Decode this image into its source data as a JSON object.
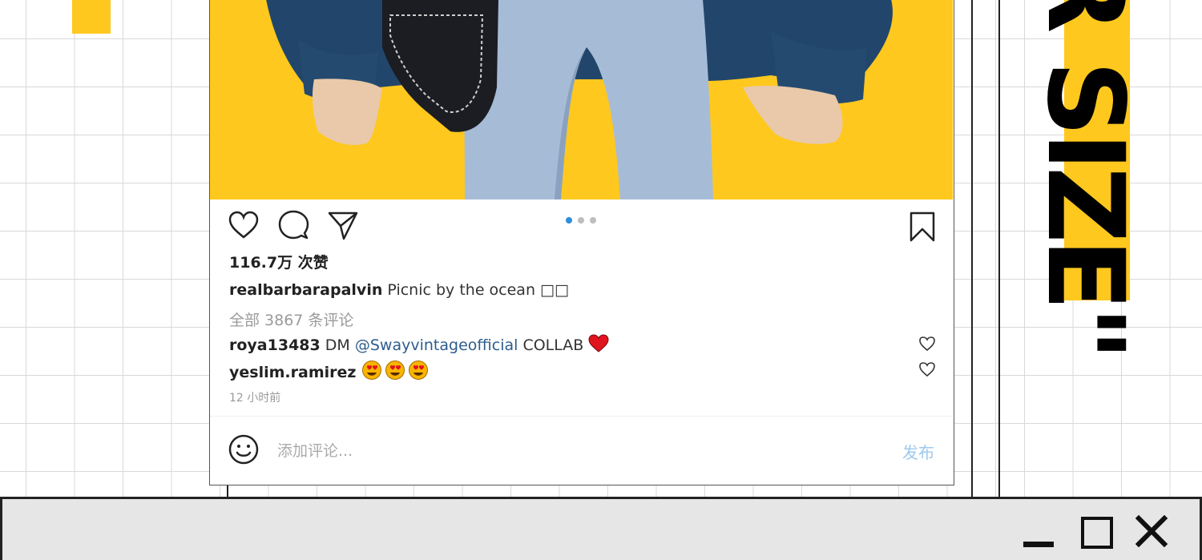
{
  "post": {
    "likes": "116.7万 次赞",
    "caption_user": "realbarbarapalvin",
    "caption_text": "Picnic by the ocean □□",
    "view_all_comments": "全部 3867 条评论",
    "comments": [
      {
        "user": "roya13483",
        "text_before": "DM",
        "mention": "@Swayvintageofficial",
        "text_after": "COLLAB",
        "emoji": "red-heart"
      },
      {
        "user": "yeslim.ramirez",
        "emoji": "heart-eyes x3"
      }
    ],
    "time": "12 小时前",
    "comment_placeholder": "添加评论...",
    "post_button": "发布",
    "carousel_dots": 3,
    "carousel_active_index": 0
  },
  "decor": {
    "side_text": "R SIZE\"",
    "accent_color": "#ffc81e",
    "link_color": "#2c5d8e",
    "active_dot_color": "#2f8ddd"
  },
  "icons": {
    "actions": [
      "heart-icon",
      "comment-icon",
      "share-icon"
    ],
    "save": "bookmark-icon",
    "emoji": "smiley-icon",
    "window": [
      "minimize-icon",
      "maximize-icon",
      "close-icon"
    ]
  }
}
